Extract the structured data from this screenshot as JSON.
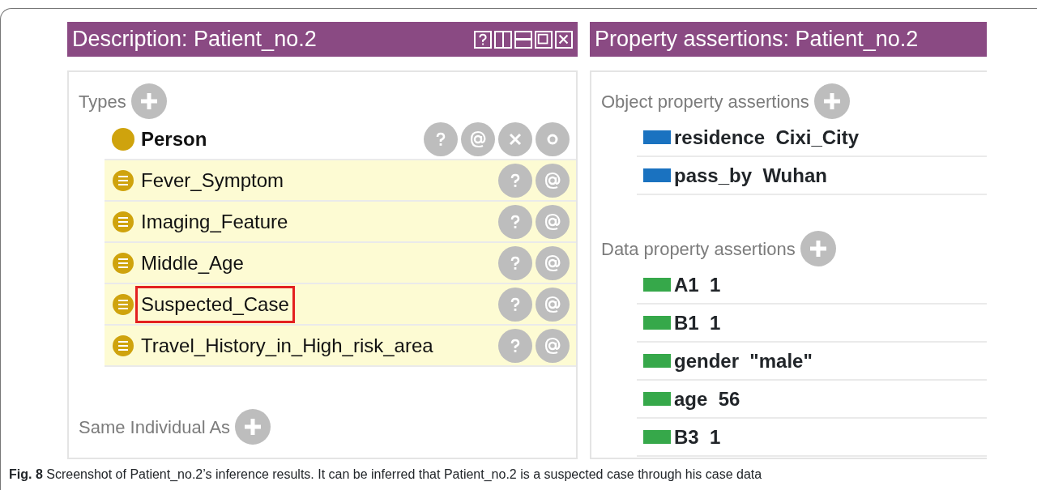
{
  "description_panel": {
    "title": "Description: Patient_no.2",
    "header_buttons": [
      {
        "kind": "help"
      },
      {
        "kind": "split-vertical"
      },
      {
        "kind": "split-horizontal"
      },
      {
        "kind": "maximize"
      },
      {
        "kind": "close"
      }
    ],
    "types": {
      "label": "Types",
      "items": [
        {
          "name": "Person",
          "kind": "asserted",
          "highlighted": false
        },
        {
          "name": "Fever_Symptom",
          "kind": "inferred",
          "highlighted": false
        },
        {
          "name": "Imaging_Feature",
          "kind": "inferred",
          "highlighted": false
        },
        {
          "name": "Middle_Age",
          "kind": "inferred",
          "highlighted": false
        },
        {
          "name": "Suspected_Case",
          "kind": "inferred",
          "highlighted": true
        },
        {
          "name": "Travel_History_in_High_risk_area",
          "kind": "inferred",
          "highlighted": false
        }
      ]
    },
    "same_individual": {
      "label": "Same Individual As"
    }
  },
  "property_panel": {
    "title": "Property assertions: Patient_no.2",
    "sections": [
      {
        "label": "Object property assertions",
        "kind": "object",
        "items": [
          {
            "property": "residence",
            "value": "Cixi_City"
          },
          {
            "property": "pass_by",
            "value": "Wuhan"
          }
        ]
      },
      {
        "label": "Data property assertions",
        "kind": "data",
        "items": [
          {
            "property": "A1",
            "value": "1"
          },
          {
            "property": "B1",
            "value": "1"
          },
          {
            "property": "gender",
            "value": "\"male\""
          },
          {
            "property": "age",
            "value": "56"
          },
          {
            "property": "B3",
            "value": "1"
          }
        ]
      }
    ]
  },
  "caption": "**Fig. 8** Screenshot of Patient_no.2’s inference results. It can be inferred that Patient_no.2 is a suspected case through his case data"
}
